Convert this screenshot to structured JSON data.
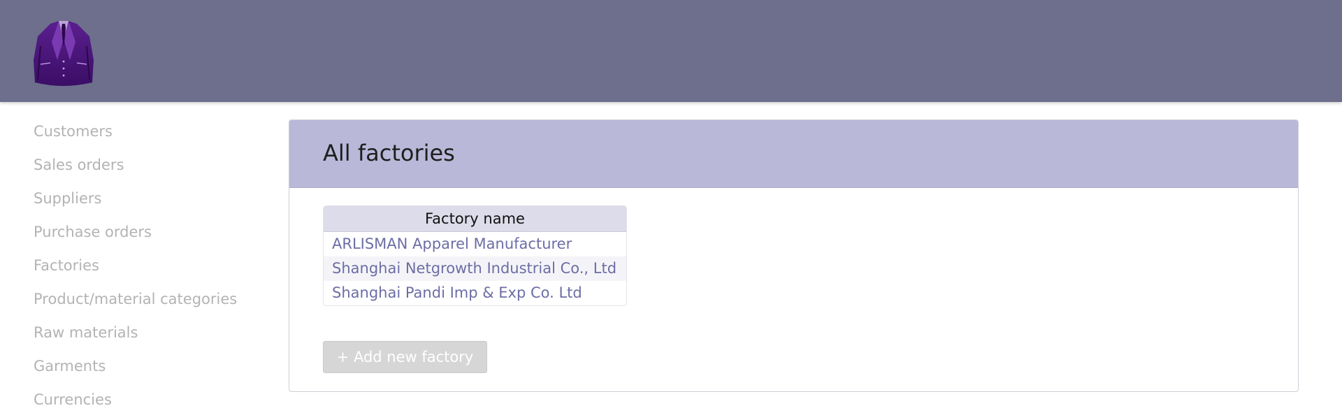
{
  "header": {
    "logo_icon": "suit-jacket-logo",
    "background": "#6d6f8d"
  },
  "sidebar": {
    "items": [
      {
        "label": "Customers"
      },
      {
        "label": "Sales orders"
      },
      {
        "label": "Suppliers"
      },
      {
        "label": "Purchase orders"
      },
      {
        "label": "Factories"
      },
      {
        "label": "Product/material categories"
      },
      {
        "label": "Raw materials"
      },
      {
        "label": "Garments"
      },
      {
        "label": "Currencies"
      }
    ]
  },
  "main": {
    "title": "All factories",
    "table": {
      "columns": [
        "Factory name"
      ],
      "rows": [
        {
          "name": "ARLISMAN Apparel Manufacturer"
        },
        {
          "name": "Shanghai Netgrowth Industrial Co., Ltd"
        },
        {
          "name": "Shanghai Pandi Imp & Exp Co. Ltd"
        }
      ]
    },
    "add_button_label": "+ Add new factory"
  },
  "colors": {
    "panel_header": "#b9b8d8",
    "link": "#6c6da5",
    "sidebar_text": "#b3b3b3"
  }
}
